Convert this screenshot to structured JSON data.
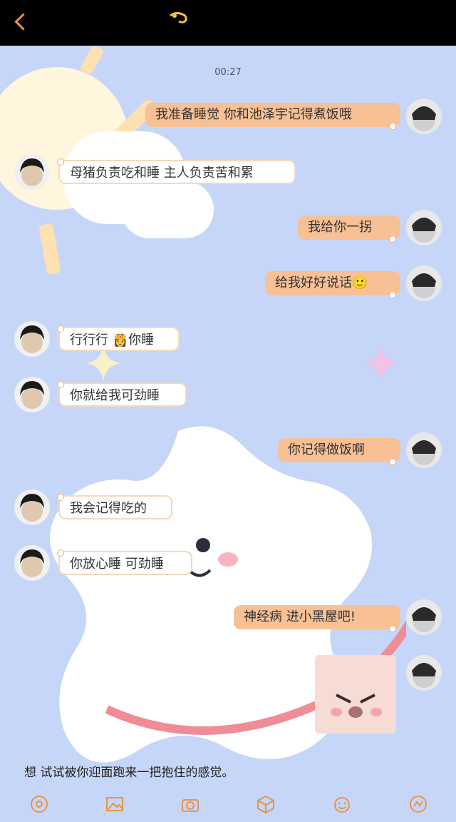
{
  "header": {
    "back_icon": "chevron-left-icon",
    "title_icon": "decorative-doodle-icon"
  },
  "timestamp": "00:27",
  "messages": [
    {
      "side": "right",
      "text": "我准备睡觉 你和池泽宇记得煮饭哦"
    },
    {
      "side": "left",
      "text": "母猪负责吃和睡 主人负责苦和累"
    },
    {
      "side": "right",
      "text": "我给你一拐"
    },
    {
      "side": "right",
      "text": "给我好好说话🙂"
    },
    {
      "side": "left",
      "text": "行行行 👸你睡"
    },
    {
      "side": "left",
      "text": "你就给我可劲睡"
    },
    {
      "side": "right",
      "text": "你记得做饭啊"
    },
    {
      "side": "left",
      "text": "我会记得吃的"
    },
    {
      "side": "left",
      "text": "你放心睡 可劲睡"
    },
    {
      "side": "right",
      "text": "神经病 进小黑屋吧!"
    }
  ],
  "sticker": {
    "type": "angry-pink-cat-sticker"
  },
  "footer_text": "想 试试被你迎面跑来一把抱住的感觉。",
  "toolbar": {
    "icons": [
      "voice-icon",
      "image-icon",
      "camera-icon",
      "gift-icon",
      "emoji-icon",
      "more-icon"
    ]
  },
  "colors": {
    "accent": "#e8934a",
    "bubble_right": "#f7c095",
    "bubble_left": "#ffffff",
    "background": "#c6d6f8"
  }
}
